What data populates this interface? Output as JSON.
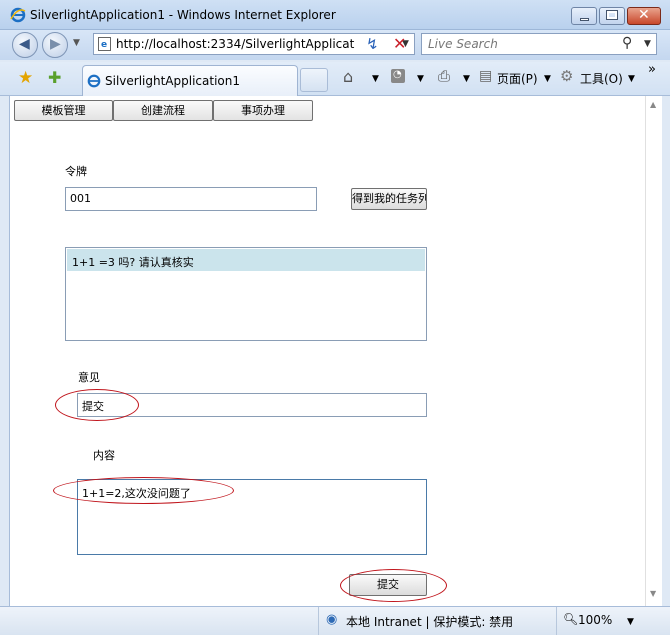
{
  "window": {
    "title": "SilverlightApplication1 - Windows Internet Explorer"
  },
  "address": {
    "url": "http://localhost:2334/SilverlightApplicat"
  },
  "search": {
    "placeholder": "Live Search"
  },
  "tab": {
    "label": "SilverlightApplication1"
  },
  "commands": {
    "page_label": "页面(P)",
    "tools_label": "工具(O)",
    "more": "»"
  },
  "app": {
    "nav_buttons": [
      "模板管理",
      "创建流程",
      "事项办理"
    ],
    "token_label": "令牌",
    "token_value": "001",
    "get_tasks_button": "得到我的任务列",
    "tasks": [
      "1+1 =3 吗? 请认真核实"
    ],
    "opinion_label": "意见",
    "opinion_value": "提交",
    "content_label": "内容",
    "content_value": "1+1=2,这次没问题了",
    "submit_button": "提交"
  },
  "status": {
    "zone": "本地 Intranet | 保护模式: 禁用",
    "zoom": "100%"
  },
  "colors": {
    "annotation": "#c0151c",
    "selected_row": "#cbe4ec"
  }
}
